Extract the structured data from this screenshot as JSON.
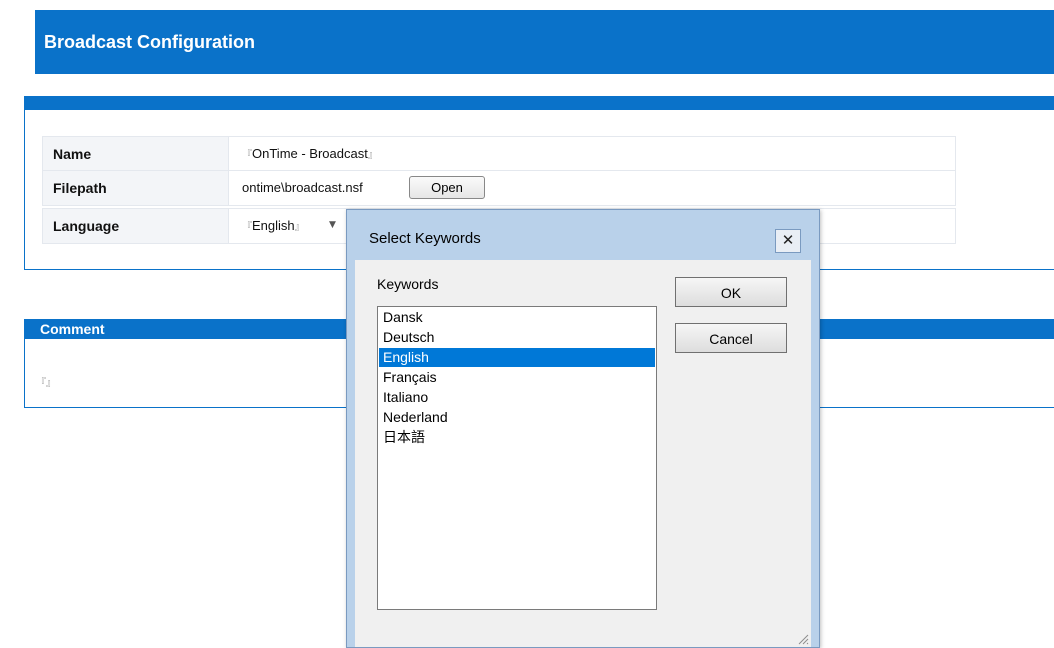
{
  "header": {
    "title": "Broadcast Configuration"
  },
  "form": {
    "name_label": "Name",
    "name_value": "OnTime - Broadcast",
    "filepath_label": "Filepath",
    "filepath_value": "ontime\\broadcast.nsf",
    "open_button": "Open",
    "language_label": "Language",
    "language_value": "English"
  },
  "comment": {
    "title": "Comment",
    "value": ""
  },
  "dialog": {
    "title": "Select Keywords",
    "keywords_label": "Keywords",
    "items": [
      "Dansk",
      "Deutsch",
      "English",
      "Français",
      "Italiano",
      "Nederland",
      "日本語"
    ],
    "selected": "English",
    "ok_label": "OK",
    "cancel_label": "Cancel",
    "close_glyph": "✕"
  },
  "colors": {
    "brand_blue": "#0a72c9",
    "selection": "#0078d7",
    "dialog_frame": "#b9d1ea"
  }
}
